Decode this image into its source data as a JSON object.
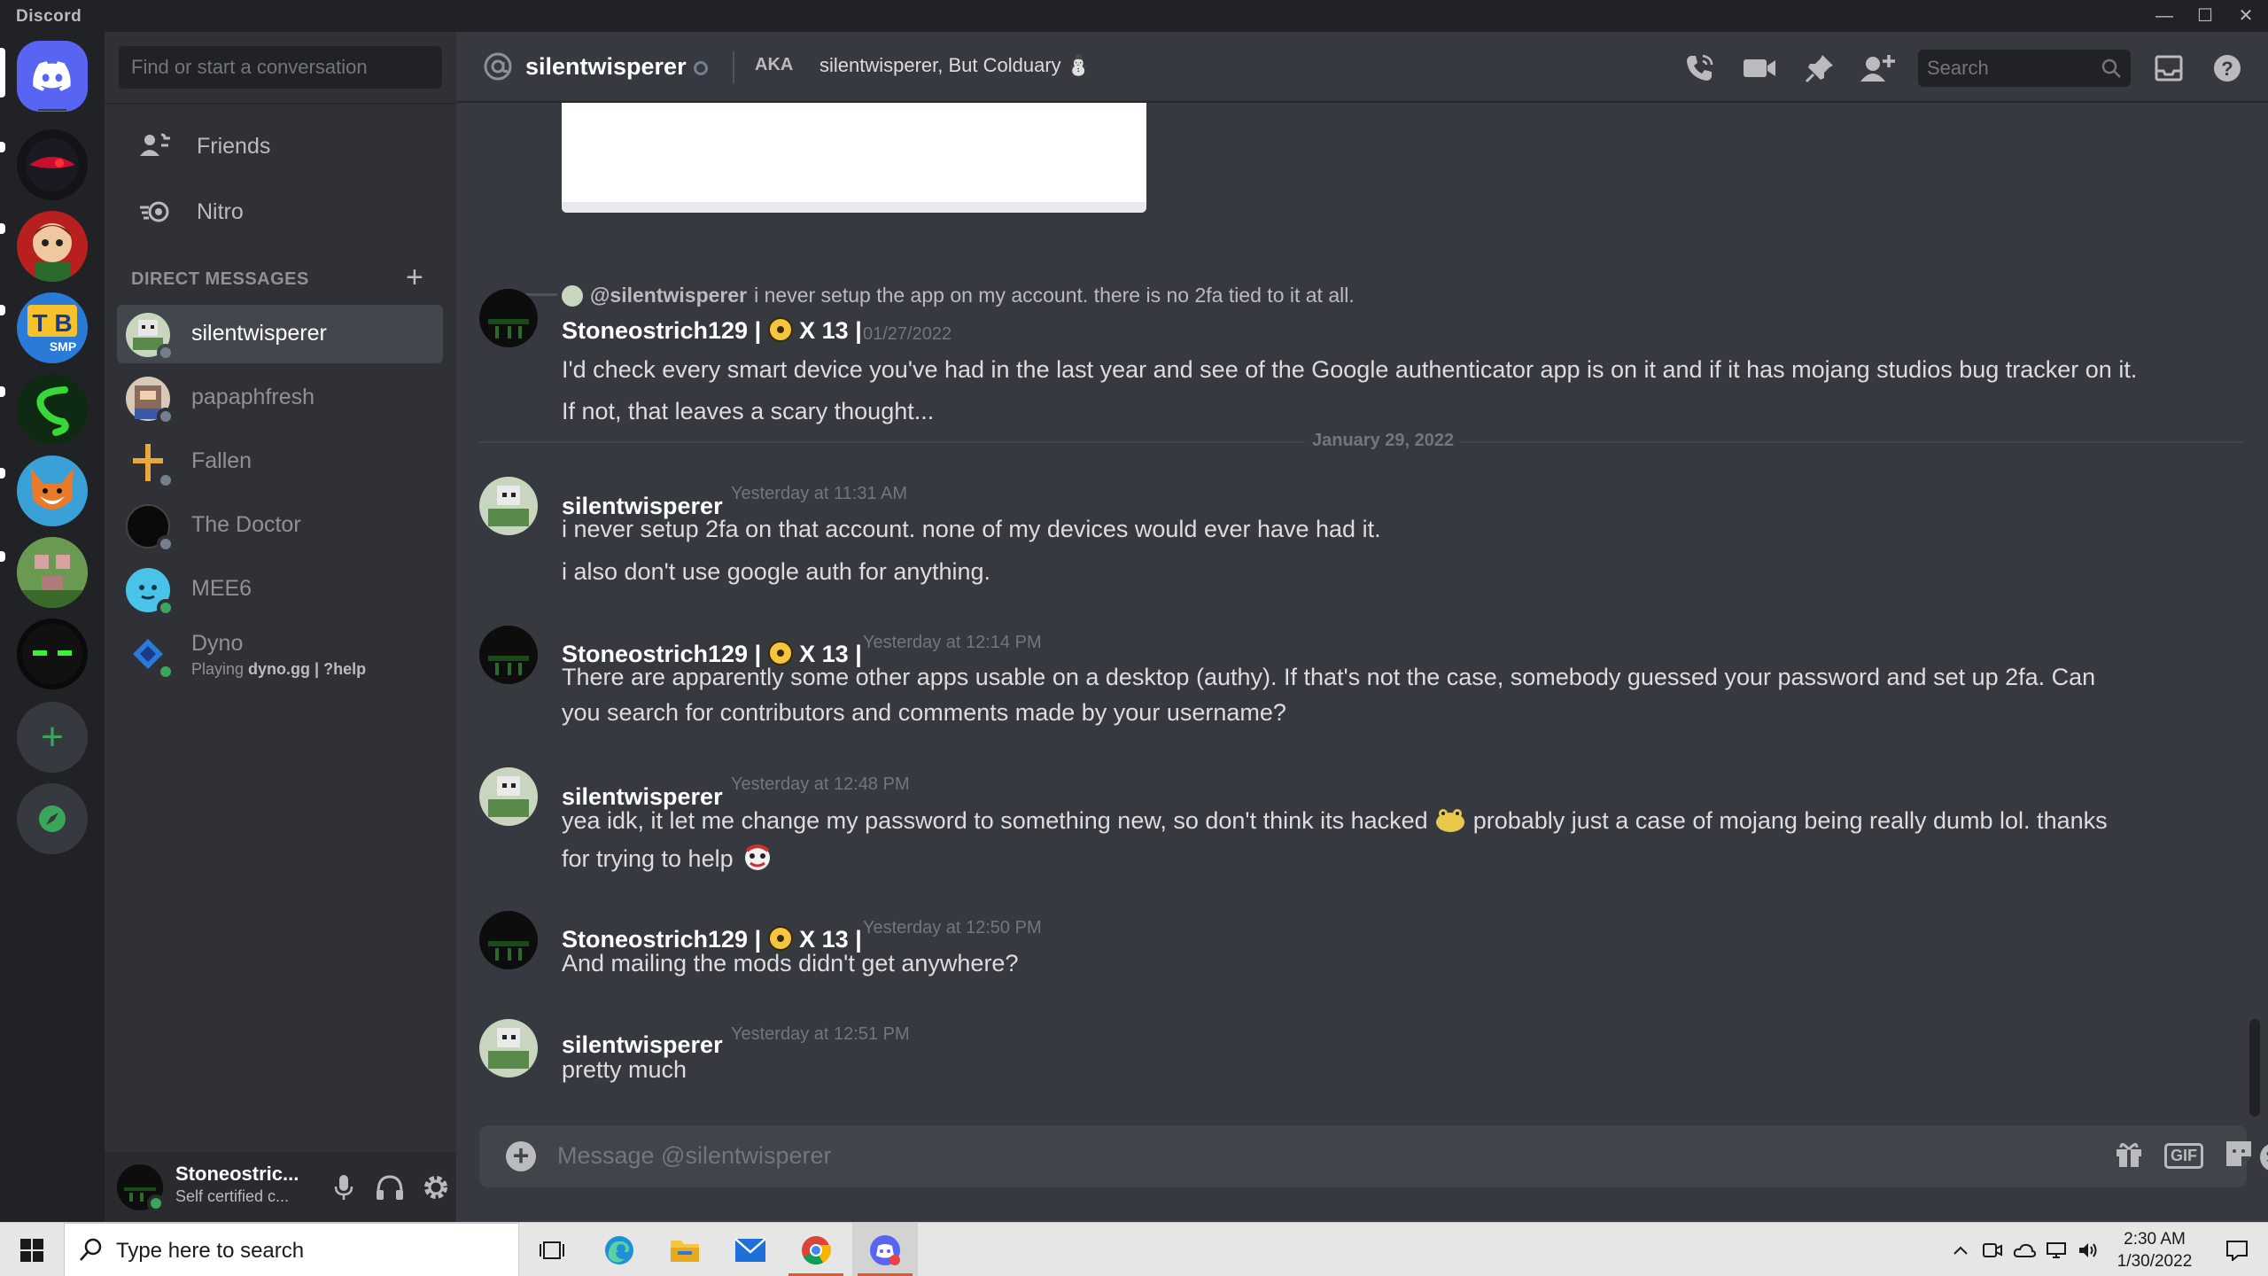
{
  "app": {
    "title": "Discord"
  },
  "window_controls": {
    "minimize": "—",
    "maximize": "☐",
    "close": "✕"
  },
  "servers": [
    "Direct Messages",
    "Server 1",
    "Server 2",
    "TB SMP",
    "Server 4",
    "Server 5",
    "Server 6",
    "Server 7"
  ],
  "rail_actions": {
    "add": "+",
    "explore": "compass"
  },
  "sidebar": {
    "search_placeholder": "Find or start a conversation",
    "nav": [
      {
        "label": "Friends",
        "icon": "friends-icon"
      },
      {
        "label": "Nitro",
        "icon": "nitro-icon"
      }
    ],
    "dm_header": "DIRECT MESSAGES",
    "dm_add": "+",
    "dms": [
      {
        "name": "silentwisperer",
        "status": "offline",
        "active": true
      },
      {
        "name": "papaphfresh",
        "status": "offline"
      },
      {
        "name": "Fallen",
        "status": "offline"
      },
      {
        "name": "The Doctor",
        "status": "offline"
      },
      {
        "name": "MEE6",
        "status": "online"
      },
      {
        "name": "Dyno",
        "status": "online",
        "activity_prefix": "Playing ",
        "activity_game": "dyno.gg | ?help"
      }
    ]
  },
  "user_panel": {
    "username": "Stoneostric...",
    "status_text": "Self certified c..."
  },
  "chat": {
    "header": {
      "title": "silentwisperer",
      "aka_label": "AKA",
      "aka_names": "silentwisperer, But Colduary ⛄",
      "search_placeholder": "Search"
    },
    "reply": {
      "mention": "@silentwisperer",
      "text": "i never setup the app on my account. there is no 2fa tied to it at all."
    },
    "divider_date": "January 29, 2022",
    "messages": [
      {
        "author": "Stoneostrich129 |",
        "badge": "X 13 |",
        "time": "01/27/2022",
        "lines": [
          "I'd check every smart device you've had in the last year and see of the Google authenticator app is on it and if it has mojang studios bug tracker on it.",
          "If not, that leaves a scary thought..."
        ]
      },
      {
        "author": "silentwisperer",
        "time": "Yesterday at 11:31 AM",
        "lines": [
          "i never setup 2fa on that account. none of my devices would ever have had it.",
          "i also don't use google auth for anything."
        ]
      },
      {
        "author": "Stoneostrich129 |",
        "badge": "X 13 |",
        "time": "Yesterday at 12:14 PM",
        "lines": [
          "There are apparently some other apps usable on a desktop (authy).  If that's not the case, somebody guessed your password and set up 2fa.  Can",
          "you search for contributors and comments made by your username?"
        ]
      },
      {
        "author": "silentwisperer",
        "time": "Yesterday at 12:48 PM",
        "lines": [
          "yea idk, it let me change my password to something new, so don't think its hacked",
          "probably just a case of mojang being really dumb lol. thanks",
          "for trying to help"
        ]
      },
      {
        "author": "Stoneostrich129 |",
        "badge": "X 13 |",
        "time": "Yesterday at 12:50 PM",
        "lines": [
          "And mailing the mods didn't get anywhere?"
        ]
      },
      {
        "author": "silentwisperer",
        "time": "Yesterday at 12:51 PM",
        "lines": [
          "pretty much"
        ]
      }
    ],
    "composer": {
      "placeholder": "Message @silentwisperer",
      "gif_label": "GIF"
    }
  },
  "taskbar": {
    "search_placeholder": "Type here to search",
    "time": "2:30 AM",
    "date": "1/30/2022"
  },
  "colors": {
    "blurple": "#5865f2",
    "online": "#3ba55c",
    "background": "#36393f",
    "sidebar": "#2f3136",
    "rail": "#202225"
  }
}
